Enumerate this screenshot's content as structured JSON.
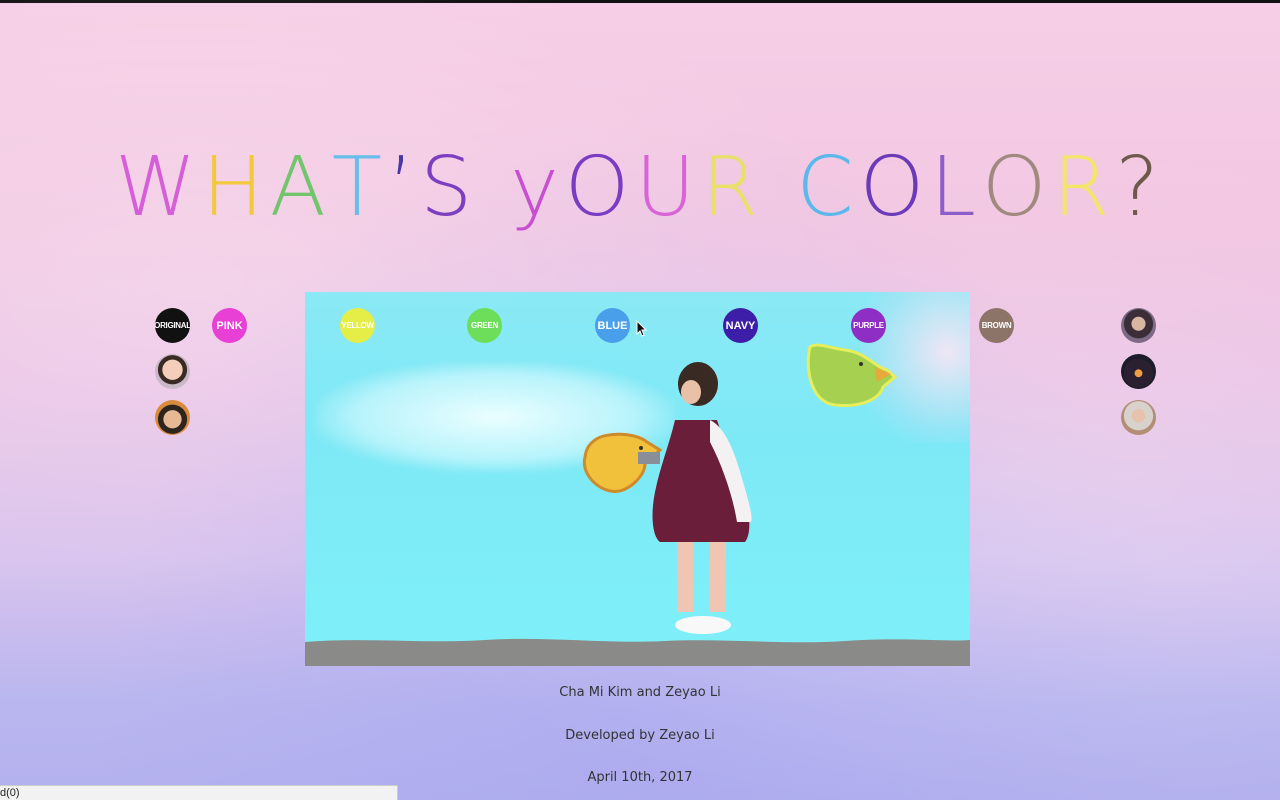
{
  "title": {
    "letters": [
      {
        "ch": "W",
        "color": "#d55fd8"
      },
      {
        "ch": "H",
        "color": "#f1c83e"
      },
      {
        "ch": "A",
        "color": "#72c56c"
      },
      {
        "ch": "T",
        "color": "#69bde9"
      },
      {
        "ch": "’",
        "color": "#4b3aa6"
      },
      {
        "ch": "S",
        "color": "#7b3fbf"
      },
      {
        "ch": " ",
        "color": "#000000"
      },
      {
        "ch": "y",
        "color": "#c84fd0"
      },
      {
        "ch": "O",
        "color": "#7a3cc2"
      },
      {
        "ch": "U",
        "color": "#d864d6"
      },
      {
        "ch": "R",
        "color": "#e8e06a"
      },
      {
        "ch": " ",
        "color": "#000000"
      },
      {
        "ch": "C",
        "color": "#5ab8ea"
      },
      {
        "ch": "O",
        "color": "#6a3ab8"
      },
      {
        "ch": "L",
        "color": "#8c5ec9"
      },
      {
        "ch": "O",
        "color": "#a08a80"
      },
      {
        "ch": "R",
        "color": "#f3e46c"
      },
      {
        "ch": "?",
        "color": "#6e5a4c"
      }
    ]
  },
  "color_buttons": {
    "original": {
      "label": "ORIGINAL",
      "color": "#111111"
    },
    "pink": {
      "label": "PINK",
      "color": "#e83fd4"
    },
    "yellow": {
      "label": "YELLOW",
      "color": "#e4ee47"
    },
    "green": {
      "label": "GREEN",
      "color": "#6dde59"
    },
    "blue": {
      "label": "BLUE",
      "color": "#4a9fea"
    },
    "navy": {
      "label": "NAVY",
      "color": "#3c1ea8"
    },
    "purple": {
      "label": "PURPLE",
      "color": "#8f2ec4"
    },
    "brown": {
      "label": "BROWN",
      "color": "#8c7468"
    }
  },
  "credits": {
    "authors": "Cha Mi Kim and Zeyao Li",
    "developer": "Developed by Zeyao Li",
    "date": "April 10th, 2017"
  },
  "status_bar": {
    "text": "d(0)"
  }
}
